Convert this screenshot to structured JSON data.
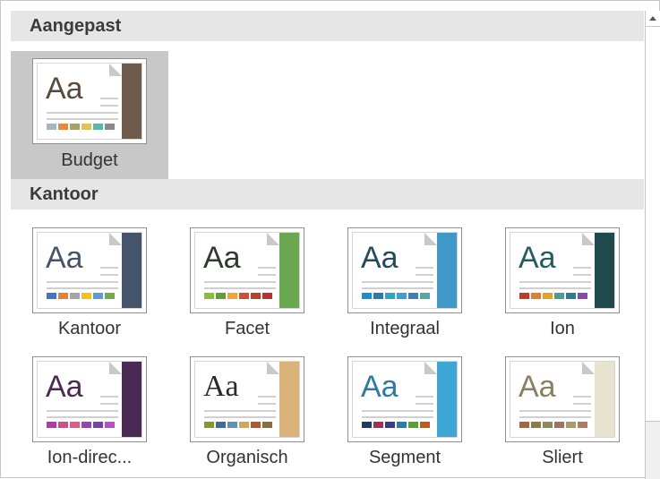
{
  "sections": [
    {
      "title": "Aangepast"
    },
    {
      "title": "Kantoor"
    }
  ],
  "themes": {
    "custom": [
      {
        "label": "Budget",
        "selected": true,
        "band": "#6f5b4c",
        "aa_color": "#5a4a3d",
        "aa_font": "Liberation Sans",
        "swatches": [
          "#a6b7c4",
          "#e38a3e",
          "#a6a06e",
          "#e0c355",
          "#5fb4a8",
          "#8a8a8a"
        ]
      }
    ],
    "office": [
      {
        "label": "Kantoor",
        "band": "#44546a",
        "aa_color": "#44546a",
        "aa_font": "Liberation Sans",
        "swatches": [
          "#4472c4",
          "#ed7d31",
          "#a5a5a5",
          "#ffc000",
          "#5b9bd5",
          "#70ad47"
        ]
      },
      {
        "label": "Facet",
        "band": "#6aa84f",
        "aa_color": "#2c3b2a",
        "aa_font": "Liberation Sans",
        "swatches": [
          "#8bbd3a",
          "#5e9e35",
          "#f2a33a",
          "#d94a2f",
          "#b9402a",
          "#c02f2f"
        ]
      },
      {
        "label": "Integraal",
        "band": "#3f98c8",
        "aa_color": "#1e4a63",
        "aa_font": "Liberation Sans",
        "swatches": [
          "#1e8fce",
          "#2b79b3",
          "#2aa6c0",
          "#34a2d8",
          "#3f7db5",
          "#4ea9a9"
        ]
      },
      {
        "label": "Ion",
        "band": "#1f4a4d",
        "aa_color": "#1f5d5f",
        "aa_font": "Liberation Sans",
        "swatches": [
          "#c0392b",
          "#e67e22",
          "#e0a326",
          "#4a9e9a",
          "#2e7d8f",
          "#8e44ad"
        ]
      },
      {
        "label": "Ion-direc...",
        "band": "#4b2a55",
        "aa_color": "#4b2a55",
        "aa_font": "Liberation Sans",
        "swatches": [
          "#b23aa8",
          "#d64a8c",
          "#e05a8a",
          "#9b3fbf",
          "#7a3fa8",
          "#c04ad0"
        ]
      },
      {
        "label": "Organisch",
        "band": "#d9b37a",
        "aa_color": "#2a2a2a",
        "aa_font": "Liberation Serif",
        "swatches": [
          "#83992a",
          "#3c6ba5",
          "#5b92b8",
          "#d2a74e",
          "#b4572f",
          "#8e6b3f"
        ]
      },
      {
        "label": "Segment",
        "band": "#3da7d6",
        "aa_color": "#2c7aa6",
        "aa_font": "Liberation Sans",
        "swatches": [
          "#1f3a66",
          "#a72c5a",
          "#3a3a8a",
          "#1e7fb3",
          "#5aa02c",
          "#c55a11"
        ]
      },
      {
        "label": "Sliert",
        "band": "#e7e3cf",
        "aa_color": "#8a8060",
        "aa_font": "Liberation Sans",
        "swatches": [
          "#a5673f",
          "#8b7d3a",
          "#8a8a5a",
          "#a3705d",
          "#a79b6b",
          "#b67a56"
        ]
      }
    ]
  }
}
